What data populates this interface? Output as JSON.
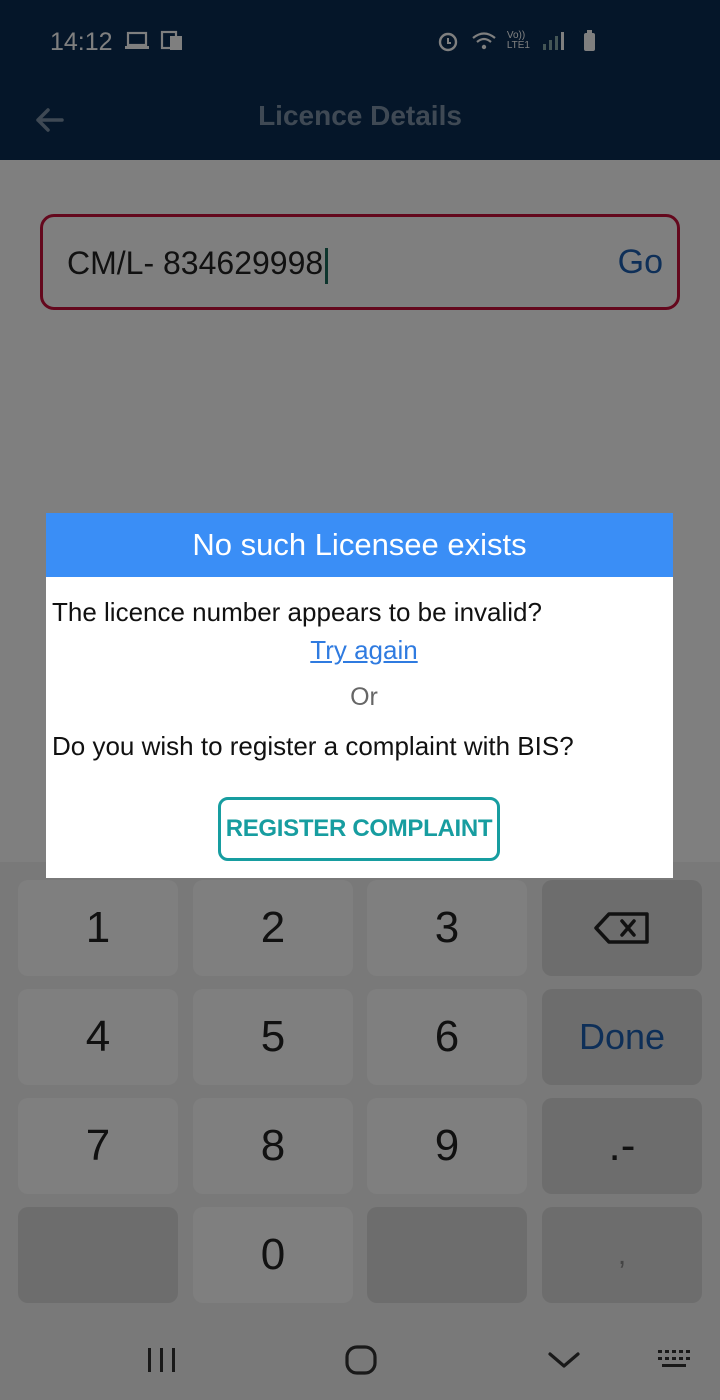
{
  "status_bar": {
    "time": "14:12",
    "left_icons": [
      "laptop-icon",
      "screen-mirror-icon"
    ],
    "right_icons": [
      "alarm-icon",
      "wifi-icon",
      "volte-icon",
      "signal-icon",
      "battery-icon"
    ],
    "volte_label": "Vo))",
    "lte_label": "LTE1"
  },
  "app_bar": {
    "title": "Licence Details",
    "back_icon": "arrow-left-icon"
  },
  "licence_input": {
    "value": "CM/L- 834629998",
    "go_label": "Go"
  },
  "dialog": {
    "title": "No such Licensee exists",
    "message": "The licence number appears to be invalid?",
    "try_again": "Try again",
    "or": "Or",
    "question": "Do you wish to register a complaint with BIS?",
    "register_button": "REGISTER COMPLAINT"
  },
  "keyboard": {
    "keys": [
      "1",
      "2",
      "3",
      "4",
      "5",
      "6",
      "7",
      "8",
      "9",
      "0"
    ],
    "backspace_icon": "backspace-icon",
    "done_label": "Done",
    "dot_dash_label": ".-",
    "comma_label": ","
  },
  "nav_bar": {
    "icons": [
      "recents-icon",
      "home-icon",
      "hide-keyboard-icon",
      "keyboard-switch-icon"
    ]
  },
  "colors": {
    "app_bar": "#0a2d52",
    "dialog_header": "#3a8ef6",
    "input_border": "#c8103a",
    "link": "#2f7be0",
    "register_button": "#179da0"
  }
}
